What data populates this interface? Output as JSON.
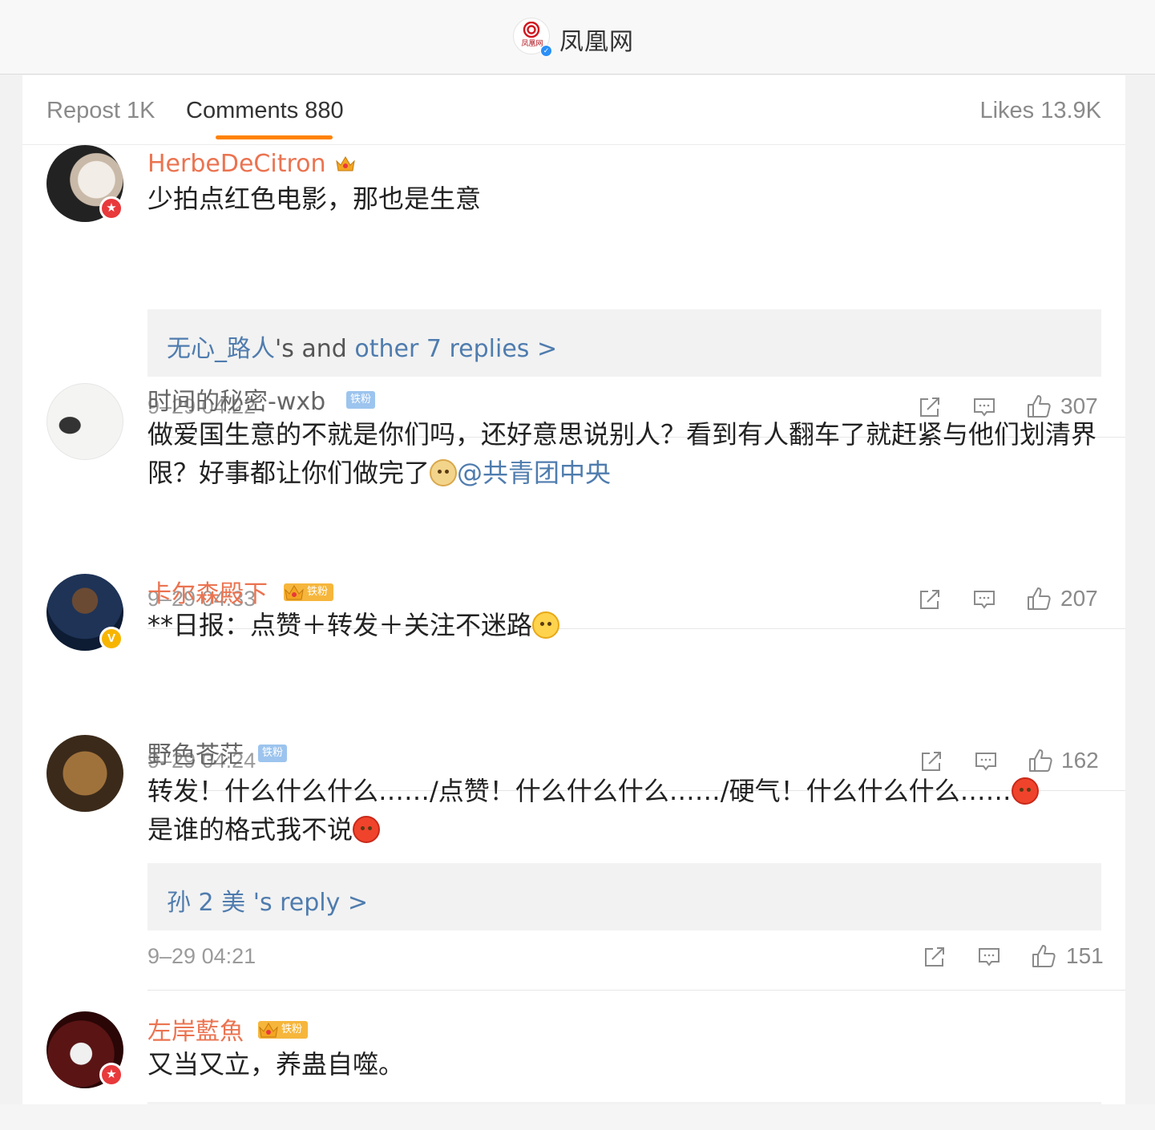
{
  "header": {
    "logo_text": "凤凰网",
    "title": "凤凰网",
    "logo_sub": "凤凰网"
  },
  "tabs": {
    "repost": "Repost 1K",
    "comments": "Comments 880",
    "likes": "Likes 13.9K"
  },
  "comments": [
    {
      "name": "HerbeDeCitron",
      "text": "少拍点红色电影，那也是生意",
      "reply_user": "无心_路人",
      "reply_mid": "'s and ",
      "reply_more": "other 7 replies >",
      "time": "9–29 04:22",
      "likes": "307"
    },
    {
      "name": "时间的秘密-wxb",
      "tag": "铁粉",
      "text": "做爱国生意的不就是你们吗，还好意思说别人？看到有人翻车了就赶紧与他们划清界限？好事都让你们做完了",
      "mention": "@共青团中央",
      "time": "9–29 04:33",
      "likes": "207"
    },
    {
      "name": "卡尔森殿下",
      "tag": "铁粉",
      "text": "**日报：点赞＋转发＋关注不迷路",
      "time": "9–29 04:24",
      "likes": "162"
    },
    {
      "name": "野色苍茫",
      "tag": "铁粉",
      "text": "转发！什么什么什么……/点赞！什么什么什么……/硬气！什么什么什么……",
      "text2": "是谁的格式我不说",
      "reply_user": "孙 2 美",
      "reply_mid": " 's reply >",
      "time": "9–29 04:21",
      "likes": "151"
    },
    {
      "name": "左岸藍魚",
      "tag": "铁粉",
      "text": "又当又立，养蛊自噬。"
    }
  ],
  "colors": {
    "accent": "#ff8200",
    "name_orange": "#eb7350",
    "link_blue": "#4f7cae"
  }
}
